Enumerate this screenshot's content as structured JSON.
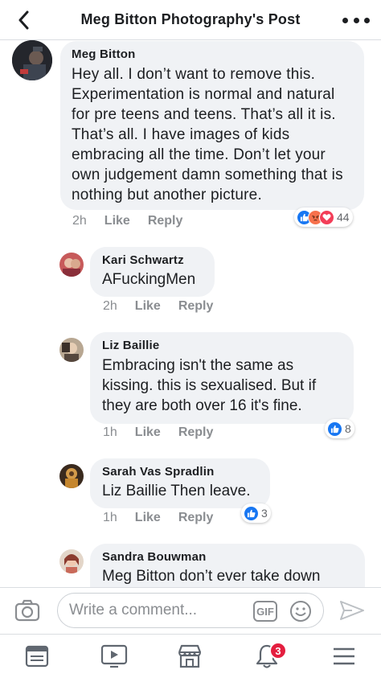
{
  "header": {
    "title": "Meg Bitton Photography's Post"
  },
  "comments": [
    {
      "author": "Meg Bitton",
      "text": "Hey all. I don’t want to remove this. Experimentation is normal and natural for pre teens and teens. That’s all it is. That’s all. I have images of kids embracing all the time. Don’t let your own judgement damn something that is nothing but another picture.",
      "time": "2h",
      "like": "Like",
      "reply": "Reply",
      "reactions": [
        "like-icon",
        "angry-icon",
        "love-icon"
      ],
      "reaction_count": "44"
    },
    {
      "author": "Kari Schwartz",
      "text": "AFuckingMen",
      "time": "2h",
      "like": "Like",
      "reply": "Reply"
    },
    {
      "author": "Liz Baillie",
      "text": "Embracing isn't the same as kissing.  this is sexualised.  But if they are both over 16 it's fine.",
      "time": "1h",
      "like": "Like",
      "reply": "Reply",
      "reactions": [
        "like-icon"
      ],
      "reaction_count": "8"
    },
    {
      "author": "Sarah Vas Spradlin",
      "text": "Liz Baillie Then leave.",
      "time": "1h",
      "like": "Like",
      "reply": "Reply",
      "reactions": [
        "like-icon"
      ],
      "reaction_count": "3"
    },
    {
      "author": "Sandra Bouwman",
      "text": "Meg Bitton  don’t ever take down"
    }
  ],
  "composer": {
    "placeholder": "Write a comment...",
    "gif_label": "GIF"
  },
  "bottom_nav": {
    "items": [
      "news-feed-icon",
      "watch-icon",
      "marketplace-icon",
      "notifications-icon",
      "menu-icon"
    ],
    "notification_badge": "3"
  },
  "colors": {
    "bubble": "#f0f2f5",
    "like_blue": "#1877f2",
    "love_red": "#f33e58",
    "angry_orange": "#f7714c",
    "badge_red": "#e41e3f",
    "muted_text": "#8a8d91"
  }
}
